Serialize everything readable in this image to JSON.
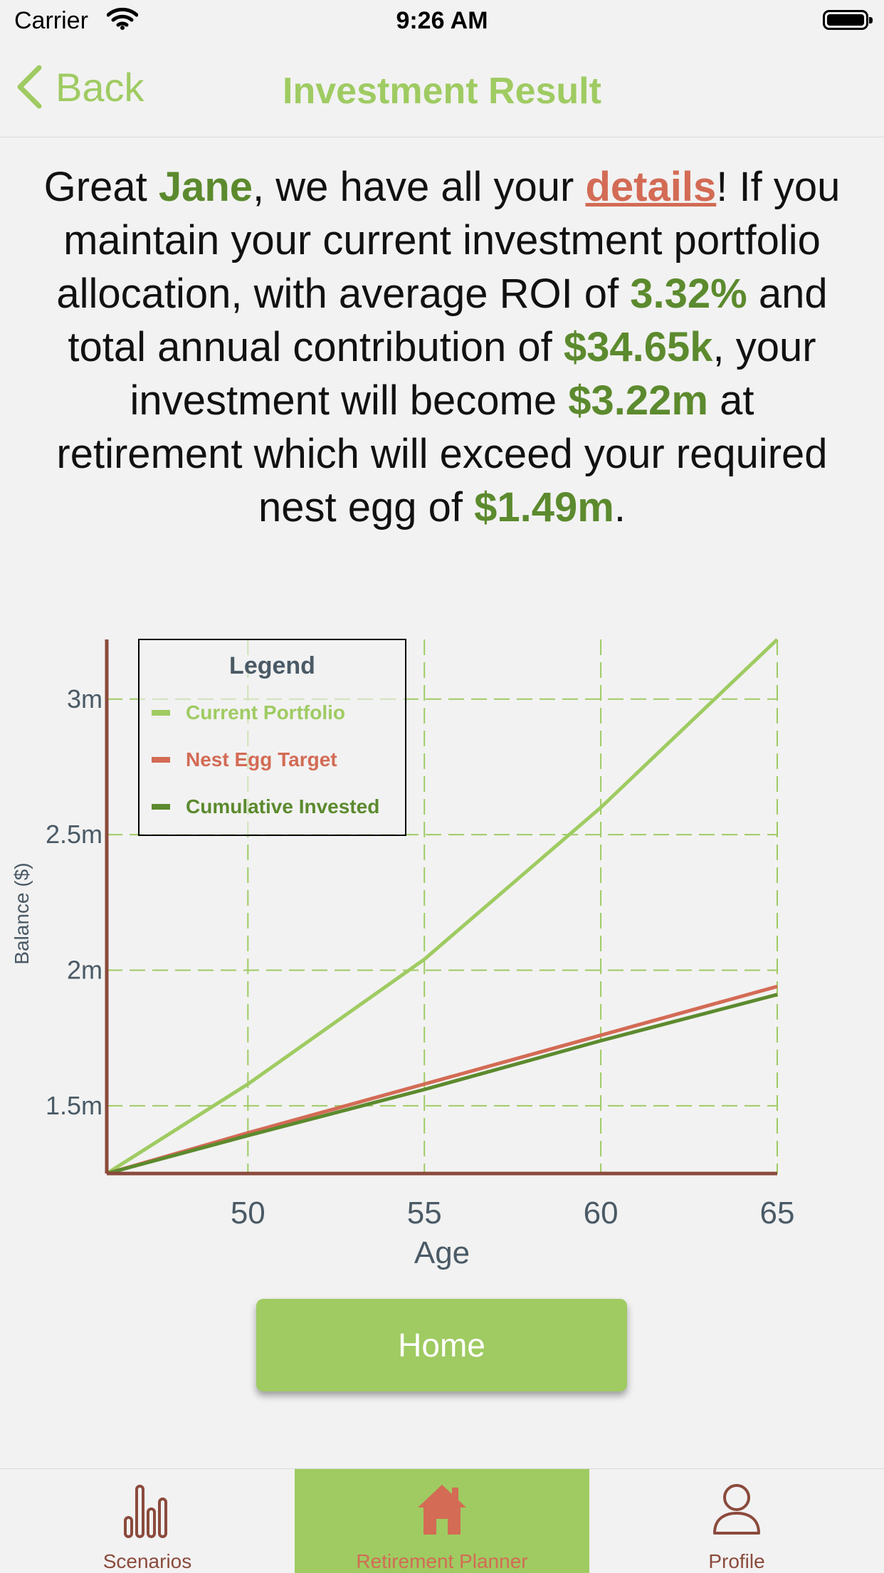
{
  "status_bar": {
    "carrier": "Carrier",
    "time": "9:26 AM"
  },
  "nav": {
    "back_label": "Back",
    "title": "Investment Result"
  },
  "summary": {
    "p1": "Great ",
    "name": "Jane",
    "p2": ", we have all your ",
    "link": "details",
    "p3": "! If you maintain your current investment portfolio allocation, with average ROI of ",
    "roi": "3.32%",
    "p4": " and total annual contribution of ",
    "contribution": "$34.65k",
    "p5": ", your investment will become ",
    "final_value": "$3.22m",
    "p6": " at retirement which will exceed your required nest egg of ",
    "nest_egg": "$1.49m",
    "p7": "."
  },
  "colors": {
    "accent": "#9fcb62",
    "dark_green": "#5c8a2e",
    "red": "#d36b55",
    "axis": "#8b4a3c"
  },
  "chart_data": {
    "type": "line",
    "xlabel": "Age",
    "ylabel": "Balance ($)",
    "xlim": [
      46,
      65
    ],
    "ylim": [
      1.25,
      3.22
    ],
    "xticks": [
      50,
      55,
      60,
      65
    ],
    "yticks": [
      {
        "value": 1.5,
        "label": "1.5m"
      },
      {
        "value": 2,
        "label": "2m"
      },
      {
        "value": 2.5,
        "label": "2.5m"
      },
      {
        "value": 3,
        "label": "3m"
      }
    ],
    "grid": true,
    "legend": {
      "title": "Legend",
      "position": "top-left"
    },
    "series": [
      {
        "name": "Current Portfolio",
        "color": "#9fcb62",
        "x": [
          46,
          50,
          55,
          60,
          65
        ],
        "y": [
          1.25,
          1.58,
          2.04,
          2.6,
          3.22
        ]
      },
      {
        "name": "Nest Egg Target",
        "color": "#d36b55",
        "x": [
          46,
          50,
          55,
          60,
          65
        ],
        "y": [
          1.25,
          1.4,
          1.58,
          1.76,
          1.94
        ]
      },
      {
        "name": "Cumulative Invested",
        "color": "#5c8a2e",
        "x": [
          46,
          50,
          55,
          60,
          65
        ],
        "y": [
          1.25,
          1.39,
          1.56,
          1.74,
          1.91
        ]
      }
    ]
  },
  "home_button": {
    "label": "Home"
  },
  "tabs": [
    {
      "label": "Scenarios",
      "icon": "bar-chart-icon",
      "active": false
    },
    {
      "label": "Retirement Planner",
      "icon": "house-icon",
      "active": true
    },
    {
      "label": "Profile",
      "icon": "person-icon",
      "active": false
    }
  ]
}
